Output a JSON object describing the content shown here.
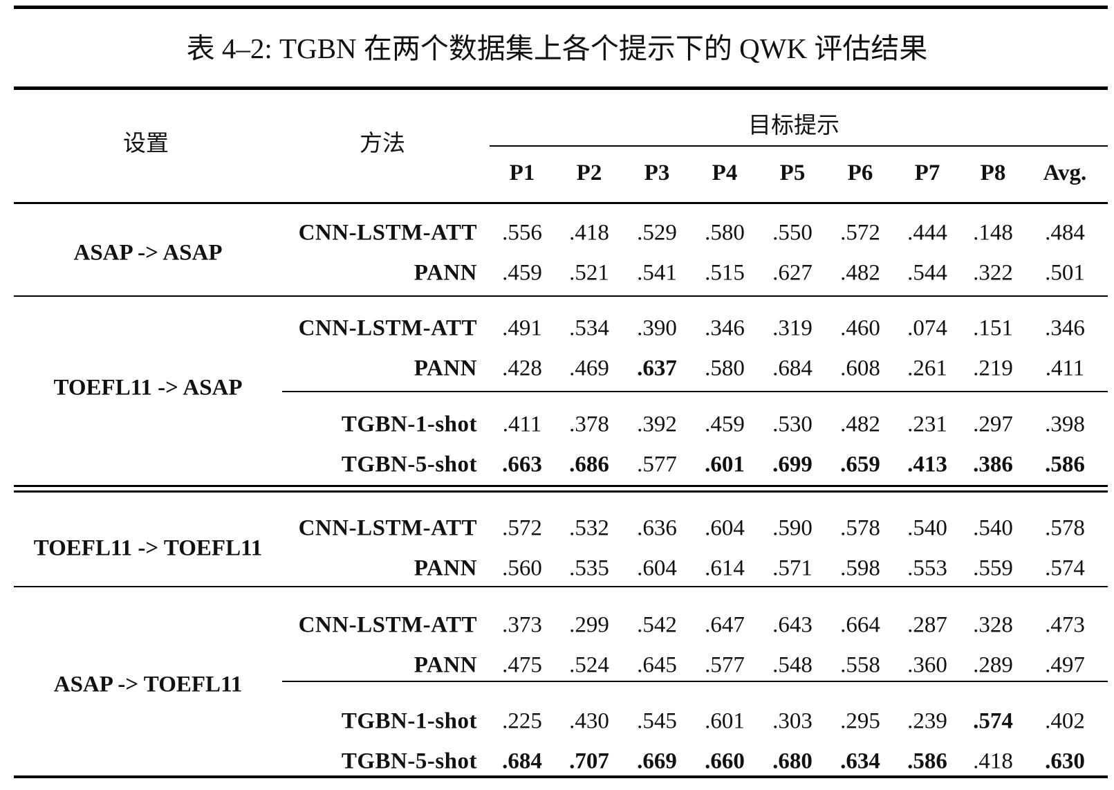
{
  "caption": "表 4–2: TGBN 在两个数据集上各个提示下的 QWK 评估结果",
  "header": {
    "setting": "设置",
    "method": "方法",
    "target": "目标提示",
    "columns": [
      "P1",
      "P2",
      "P3",
      "P4",
      "P5",
      "P6",
      "P7",
      "P8",
      "Avg."
    ]
  },
  "groups": [
    {
      "setting": "ASAP -> ASAP",
      "rows": [
        {
          "method": "CNN-LSTM-ATT",
          "values": [
            ".556",
            ".418",
            ".529",
            ".580",
            ".550",
            ".572",
            ".444",
            ".148",
            ".484"
          ],
          "bold": []
        },
        {
          "method": "PANN",
          "values": [
            ".459",
            ".521",
            ".541",
            ".515",
            ".627",
            ".482",
            ".544",
            ".322",
            ".501"
          ],
          "bold": []
        }
      ]
    },
    {
      "setting": "TOEFL11 -> ASAP",
      "rows": [
        {
          "method": "CNN-LSTM-ATT",
          "values": [
            ".491",
            ".534",
            ".390",
            ".346",
            ".319",
            ".460",
            ".074",
            ".151",
            ".346"
          ],
          "bold": []
        },
        {
          "method": "PANN",
          "values": [
            ".428",
            ".469",
            ".637",
            ".580",
            ".684",
            ".608",
            ".261",
            ".219",
            ".411"
          ],
          "bold": [
            2
          ]
        },
        {
          "method": "TGBN-1-shot",
          "values": [
            ".411",
            ".378",
            ".392",
            ".459",
            ".530",
            ".482",
            ".231",
            ".297",
            ".398"
          ],
          "bold": []
        },
        {
          "method": "TGBN-5-shot",
          "values": [
            ".663",
            ".686",
            ".577",
            ".601",
            ".699",
            ".659",
            ".413",
            ".386",
            ".586"
          ],
          "bold": [
            0,
            1,
            3,
            4,
            5,
            6,
            7,
            8
          ]
        }
      ]
    },
    {
      "setting": "TOEFL11 -> TOEFL11",
      "rows": [
        {
          "method": "CNN-LSTM-ATT",
          "values": [
            ".572",
            ".532",
            ".636",
            ".604",
            ".590",
            ".578",
            ".540",
            ".540",
            ".578"
          ],
          "bold": []
        },
        {
          "method": "PANN",
          "values": [
            ".560",
            ".535",
            ".604",
            ".614",
            ".571",
            ".598",
            ".553",
            ".559",
            ".574"
          ],
          "bold": []
        }
      ]
    },
    {
      "setting": "ASAP -> TOEFL11",
      "rows": [
        {
          "method": "CNN-LSTM-ATT",
          "values": [
            ".373",
            ".299",
            ".542",
            ".647",
            ".643",
            ".664",
            ".287",
            ".328",
            ".473"
          ],
          "bold": []
        },
        {
          "method": "PANN",
          "values": [
            ".475",
            ".524",
            ".645",
            ".577",
            ".548",
            ".558",
            ".360",
            ".289",
            ".497"
          ],
          "bold": []
        },
        {
          "method": "TGBN-1-shot",
          "values": [
            ".225",
            ".430",
            ".545",
            ".601",
            ".303",
            ".295",
            ".239",
            ".574",
            ".402"
          ],
          "bold": [
            7
          ]
        },
        {
          "method": "TGBN-5-shot",
          "values": [
            ".684",
            ".707",
            ".669",
            ".660",
            ".680",
            ".634",
            ".586",
            ".418",
            ".630"
          ],
          "bold": [
            0,
            1,
            2,
            3,
            4,
            5,
            6,
            8
          ]
        }
      ]
    }
  ]
}
